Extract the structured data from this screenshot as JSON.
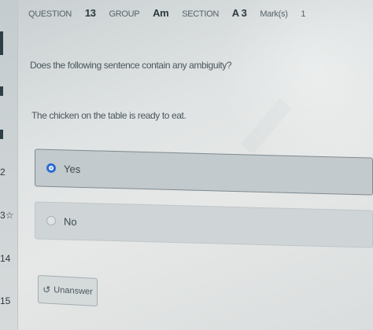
{
  "header": {
    "question_label": "QUESTION",
    "question_number": "13",
    "group_label": "GROUP",
    "group_value": "Am",
    "section_label": "SECTION",
    "section_value": "A 3",
    "marks_label": "Mark(s)",
    "marks_value": "1"
  },
  "question": {
    "prompt": "Does the following sentence contain any ambiguity?",
    "sentence": "The chicken on the table is ready to eat."
  },
  "options": [
    {
      "label": "Yes",
      "selected": true
    },
    {
      "label": "No",
      "selected": false
    }
  ],
  "actions": {
    "unanswer_label": "Unanswer"
  },
  "sidebar": {
    "items": [
      {
        "label": "2"
      },
      {
        "label": "3",
        "flag": "☆"
      },
      {
        "label": "14"
      },
      {
        "label": "15"
      }
    ]
  },
  "colors": {
    "accent": "#2b6bd6",
    "selected_border": "#7f8a8f"
  }
}
